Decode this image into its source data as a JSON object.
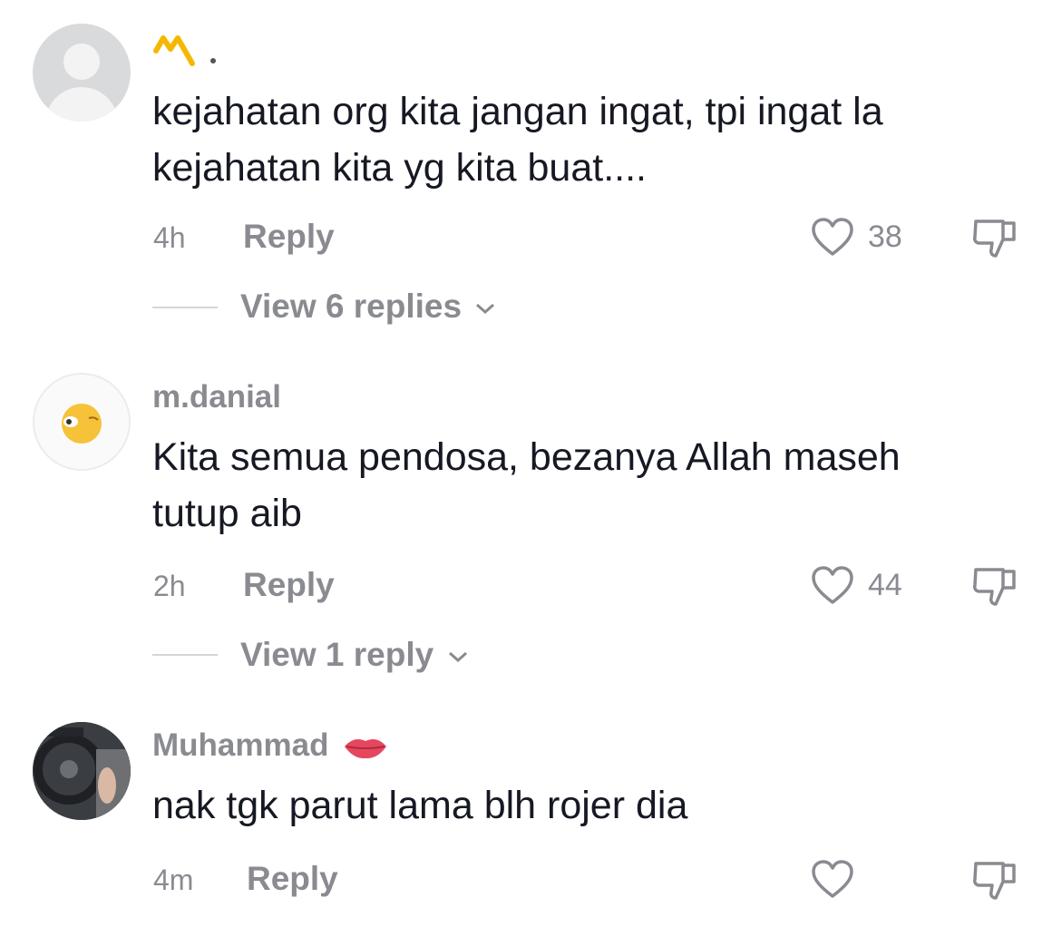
{
  "comments": [
    {
      "username": "ᴍ.",
      "text_line1": "kejahatan org kita jangan ingat, tpi ingat la",
      "text_line2": "kejahatan kita yg kita buat....",
      "time": "4h",
      "reply_label": "Reply",
      "likes": "38",
      "view_replies": "View 6 replies",
      "avatar": "default-avatar-icon"
    },
    {
      "username": "m.danial",
      "text_line1": "Kita semua pendosa, bezanya Allah maseh",
      "text_line2": "tutup aib",
      "time": "2h",
      "reply_label": "Reply",
      "likes": "44",
      "view_replies": "View 1 reply",
      "avatar": "emoji-avatar-icon"
    },
    {
      "username": "Muhammad",
      "text_line1": "nak tgk parut lama blh rojer dia",
      "time": "4m",
      "reply_label": "Reply",
      "likes": "",
      "avatar": "car-steering-photo"
    }
  ],
  "icons": {
    "like": "heart-outline-icon",
    "dislike": "thumbs-down-icon",
    "chevron": "chevron-down-icon",
    "username_badge": "lips-emoji-icon"
  },
  "colors": {
    "text": "#161823",
    "muted": "#8a8b91",
    "username_mark": "#f5b800"
  }
}
